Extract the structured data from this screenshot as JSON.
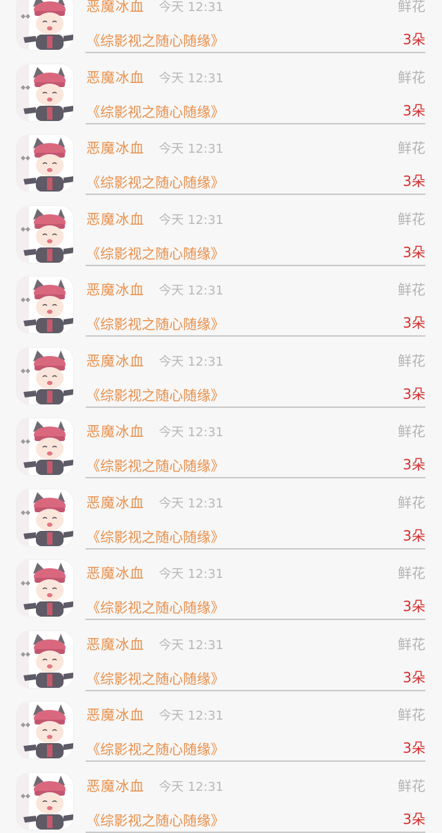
{
  "records": [
    {
      "user": "恶魔冰血",
      "time": "今天 12:31",
      "gift": "鲜花",
      "book": "《综影视之随心随缘》",
      "amount": "3朵"
    },
    {
      "user": "恶魔冰血",
      "time": "今天 12:31",
      "gift": "鲜花",
      "book": "《综影视之随心随缘》",
      "amount": "3朵"
    },
    {
      "user": "恶魔冰血",
      "time": "今天 12:31",
      "gift": "鲜花",
      "book": "《综影视之随心随缘》",
      "amount": "3朵"
    },
    {
      "user": "恶魔冰血",
      "time": "今天 12:31",
      "gift": "鲜花",
      "book": "《综影视之随心随缘》",
      "amount": "3朵"
    },
    {
      "user": "恶魔冰血",
      "time": "今天 12:31",
      "gift": "鲜花",
      "book": "《综影视之随心随缘》",
      "amount": "3朵"
    },
    {
      "user": "恶魔冰血",
      "time": "今天 12:31",
      "gift": "鲜花",
      "book": "《综影视之随心随缘》",
      "amount": "3朵"
    },
    {
      "user": "恶魔冰血",
      "time": "今天 12:31",
      "gift": "鲜花",
      "book": "《综影视之随心随缘》",
      "amount": "3朵"
    },
    {
      "user": "恶魔冰血",
      "time": "今天 12:31",
      "gift": "鲜花",
      "book": "《综影视之随心随缘》",
      "amount": "3朵"
    },
    {
      "user": "恶魔冰血",
      "time": "今天 12:31",
      "gift": "鲜花",
      "book": "《综影视之随心随缘》",
      "amount": "3朵"
    },
    {
      "user": "恶魔冰血",
      "time": "今天 12:31",
      "gift": "鲜花",
      "book": "《综影视之随心随缘》",
      "amount": "3朵"
    },
    {
      "user": "恶魔冰血",
      "time": "今天 12:31",
      "gift": "鲜花",
      "book": "《综影视之随心随缘》",
      "amount": "3朵"
    },
    {
      "user": "恶魔冰血",
      "time": "今天 12:31",
      "gift": "鲜花",
      "book": "《综影视之随心随缘》",
      "amount": "3朵"
    }
  ],
  "avatar_icon": "cartoon-boy-cat-ears-cap-icon",
  "colors": {
    "username": "#e8904c",
    "time": "#b8b8b8",
    "gift_type": "#b3b3b3",
    "amount": "#d62f2f",
    "divider": "#c9c9c9",
    "background": "#f7f7f7"
  }
}
